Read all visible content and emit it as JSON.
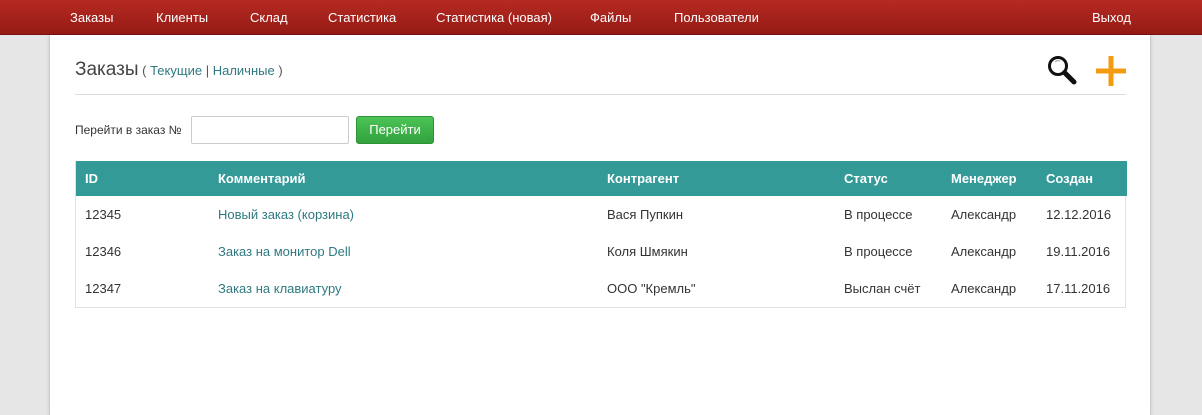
{
  "nav": {
    "items": [
      "Заказы",
      "Клиенты",
      "Склад",
      "Статистика",
      "Статистика (новая)",
      "Файлы",
      "Пользователи"
    ],
    "logout": "Выход"
  },
  "header": {
    "title": "Заказы",
    "paren_open": "(",
    "link_current": "Текущие",
    "separator": "|",
    "link_cash": "Наличные",
    "paren_close": ")",
    "search_icon": "search-icon",
    "add_icon": "plus-icon",
    "add_icon_color": "#f39c12"
  },
  "goto": {
    "label": "Перейти в заказ №",
    "value": "",
    "button": "Перейти"
  },
  "table": {
    "header_color": "#339a97",
    "columns": [
      "ID",
      "Комментарий",
      "Контрагент",
      "Статус",
      "Менеджер",
      "Создан"
    ],
    "rows": [
      [
        "12345",
        "Новый заказ (корзина)",
        "Вася Пупкин",
        "В процессе",
        "Александр",
        "12.12.2016"
      ],
      [
        "12346",
        "Заказ на монитор Dell",
        "Коля Шмякин",
        "В процессе",
        "Александр",
        "19.11.2016"
      ],
      [
        "12347",
        "Заказ на клавиатуру",
        "ООО \"Кремль\"",
        "Выслан счёт",
        "Александр",
        "17.11.2016"
      ]
    ]
  }
}
